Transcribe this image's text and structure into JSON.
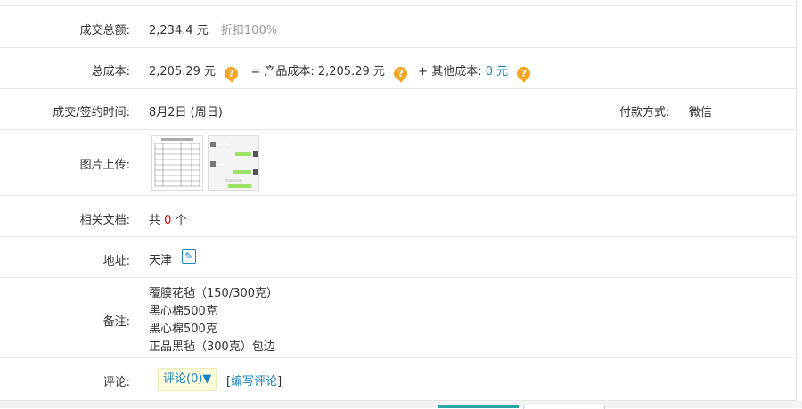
{
  "deal_total": {
    "label": "成交总额:",
    "amount": "2,234.4 元",
    "discount": "折扣100%"
  },
  "total_cost": {
    "label": "总成本:",
    "amount": "2,205.29 元",
    "product_cost_label": "= 产品成本:",
    "product_cost_value": "2,205.29 元",
    "other_cost_label": "+ 其他成本:",
    "other_cost_value": "0 元"
  },
  "deal_time": {
    "label": "成交/签约时间:",
    "value": "8月2日 (周日)",
    "payment_label": "付款方式:",
    "payment_value": "微信"
  },
  "images": {
    "label": "图片上传:"
  },
  "documents": {
    "label": "相关文档:",
    "prefix": "共",
    "count": "0",
    "suffix": "个"
  },
  "address": {
    "label": "地址:",
    "value": "天津"
  },
  "notes": {
    "label": "备注:",
    "lines": [
      "覆膜花毡（150/300克）",
      "黑心棉500克",
      "黑心棉500克",
      "正品黑毡（300克）包边"
    ]
  },
  "comments": {
    "label": "评论:",
    "button": "评论(0)▼",
    "write_link": "编写评论"
  },
  "colors": {
    "link": "#1a85c4",
    "help_icon": "#f5a623",
    "highlight": "#e00000",
    "primary_button": "#2aa7a0"
  },
  "icons": {
    "help": "question-circle-icon",
    "edit": "edit-icon"
  }
}
